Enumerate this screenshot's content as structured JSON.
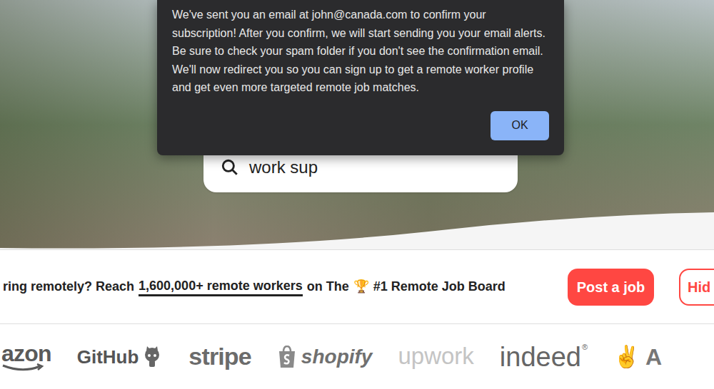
{
  "dialog": {
    "message": "We've sent you an email at john@canada.com to confirm your subscription! After you confirm, we will start sending you your email alerts. Be sure to check your spam folder if you don't see the confirmation email. We'll now redirect you so you can sign up to get a remote worker profile and get even more targeted remote job matches.",
    "button": "OK"
  },
  "search": {
    "value": "work sup"
  },
  "banner": {
    "lead": "ring remotely? Reach",
    "link": "1,600,000+ remote workers",
    "middle": "on The",
    "trophy": "🏆",
    "tail": "#1 Remote Job Board",
    "buttons": [
      {
        "label": "Post a job",
        "kind": "filled"
      },
      {
        "label": "Hid",
        "kind": "outline"
      }
    ]
  },
  "logos": [
    {
      "text": "azon",
      "kind": "amazon"
    },
    {
      "text": "GitHub",
      "kind": "github"
    },
    {
      "text": "stripe",
      "kind": "stripe"
    },
    {
      "text": "shopify",
      "kind": "shopify"
    },
    {
      "text": "upwork",
      "kind": "upwork"
    },
    {
      "text": "indeed",
      "mark": "®",
      "kind": "indeed"
    },
    {
      "text": "A",
      "mark": "✌",
      "kind": "partial"
    }
  ]
}
